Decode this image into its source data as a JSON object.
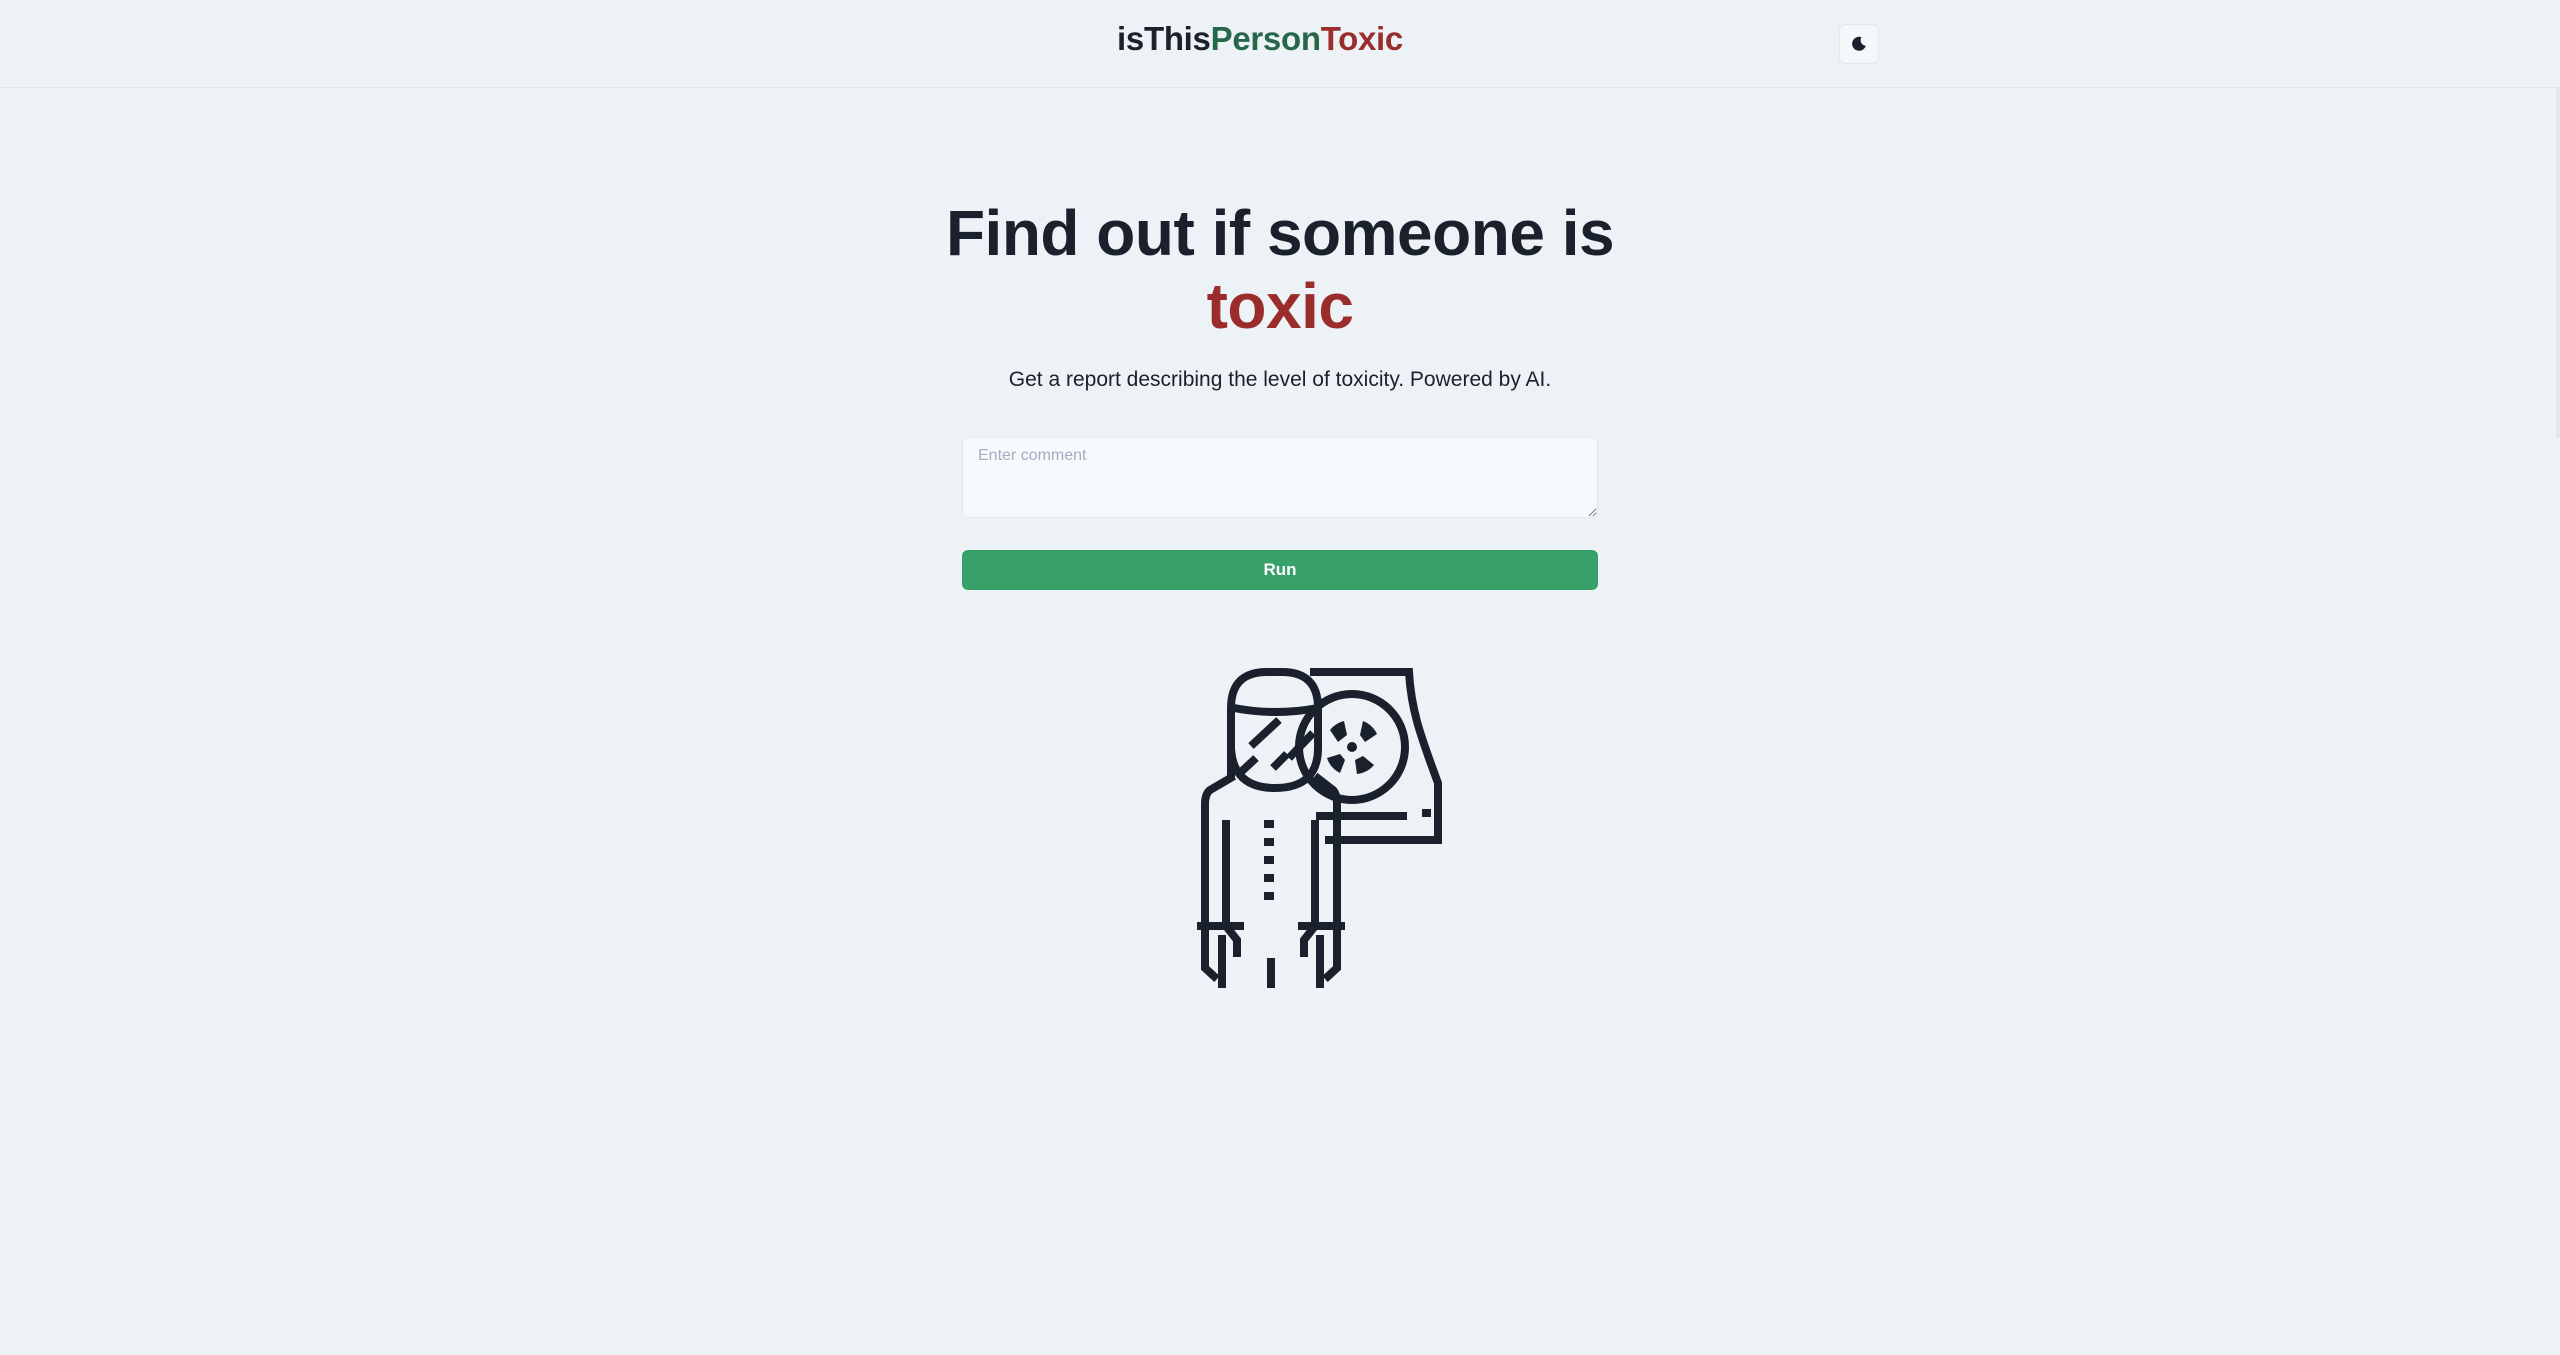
{
  "header": {
    "logo_part1": "isThis",
    "logo_part2": "Person",
    "logo_part3": "Toxic",
    "theme_toggle_icon": "moon-icon"
  },
  "hero": {
    "title_line1": "Find out if someone is",
    "title_accent": "toxic",
    "subtitle": "Get a report describing the level of toxicity. Powered by AI."
  },
  "form": {
    "comment_placeholder": "Enter comment",
    "comment_value": "",
    "run_label": "Run"
  },
  "illustration": {
    "icon": "hazmat-worker-radiation-icon"
  },
  "colors": {
    "background": "#edf2f7",
    "text": "#1a202c",
    "green_accent": "#276749",
    "red_accent": "#9b2c2c",
    "button": "#38a169"
  }
}
